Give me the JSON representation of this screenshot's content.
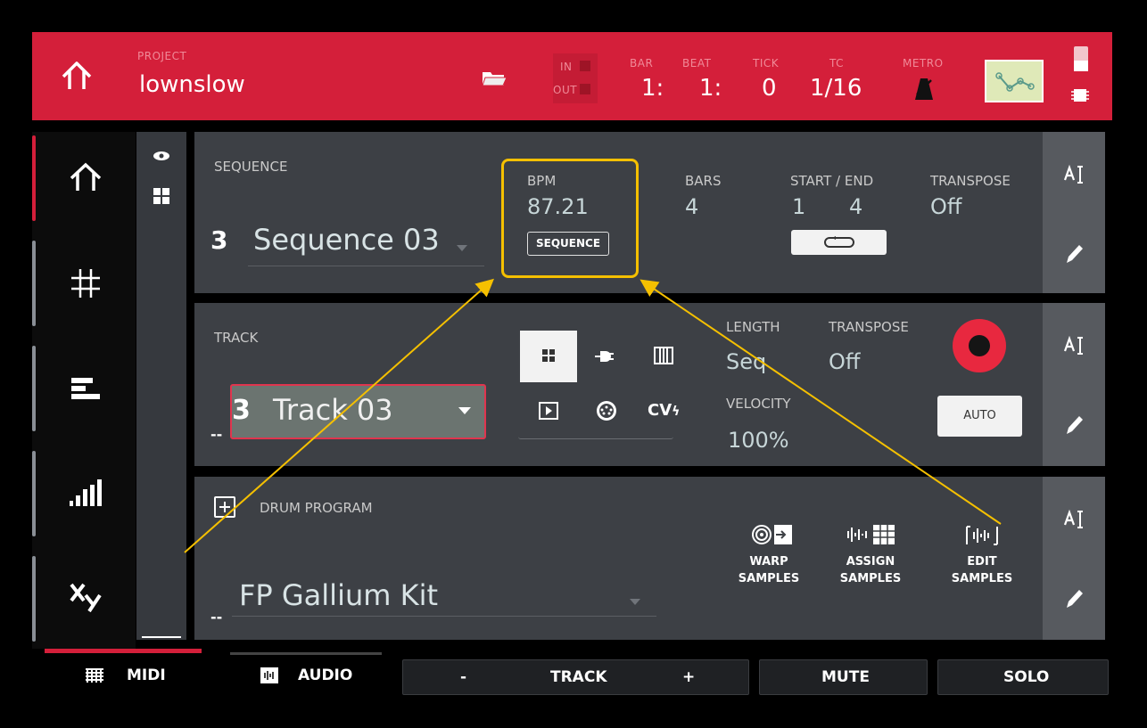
{
  "header": {
    "project_label": "PROJECT",
    "project_name": "lownslow",
    "in_label": "IN",
    "out_label": "OUT",
    "bar_label": "BAR",
    "bar_value": "1:",
    "beat_label": "BEAT",
    "beat_value": "1:",
    "tick_label": "TICK",
    "tick_value": "0",
    "tc_label": "TC",
    "tc_value": "1/16",
    "metro_label": "METRO"
  },
  "sequence": {
    "label": "SEQUENCE",
    "number": "3",
    "name": "Sequence 03",
    "bpm_label": "BPM",
    "bpm_value": "87.21",
    "bpm_mode": "SEQUENCE",
    "bars_label": "BARS",
    "bars_value": "4",
    "startend_label": "START / END",
    "start_value": "1",
    "end_value": "4",
    "transpose_label": "TRANSPOSE",
    "transpose_value": "Off"
  },
  "track": {
    "label": "TRACK",
    "number": "3",
    "name": "Track 03",
    "dash": "--",
    "length_label": "LENGTH",
    "length_value": "Seq",
    "transpose_label": "TRANSPOSE",
    "transpose_value": "Off",
    "velocity_label": "VELOCITY",
    "velocity_value": "100%",
    "cv_label": "CV",
    "auto_label": "AUTO"
  },
  "program": {
    "label": "DRUM PROGRAM",
    "name": "FP Gallium Kit",
    "dash": "--",
    "warp": [
      "WARP",
      "SAMPLES"
    ],
    "assign": [
      "ASSIGN",
      "SAMPLES"
    ],
    "edit": [
      "EDIT",
      "SAMPLES"
    ]
  },
  "bottom": {
    "midi": "MIDI",
    "audio": "AUDIO",
    "minus": "-",
    "track": "TRACK",
    "plus": "+",
    "mute": "MUTE",
    "solo": "SOLO"
  },
  "colors": {
    "header": "#d41f3a",
    "accent": "#f5c000",
    "record": "#e8283f"
  }
}
